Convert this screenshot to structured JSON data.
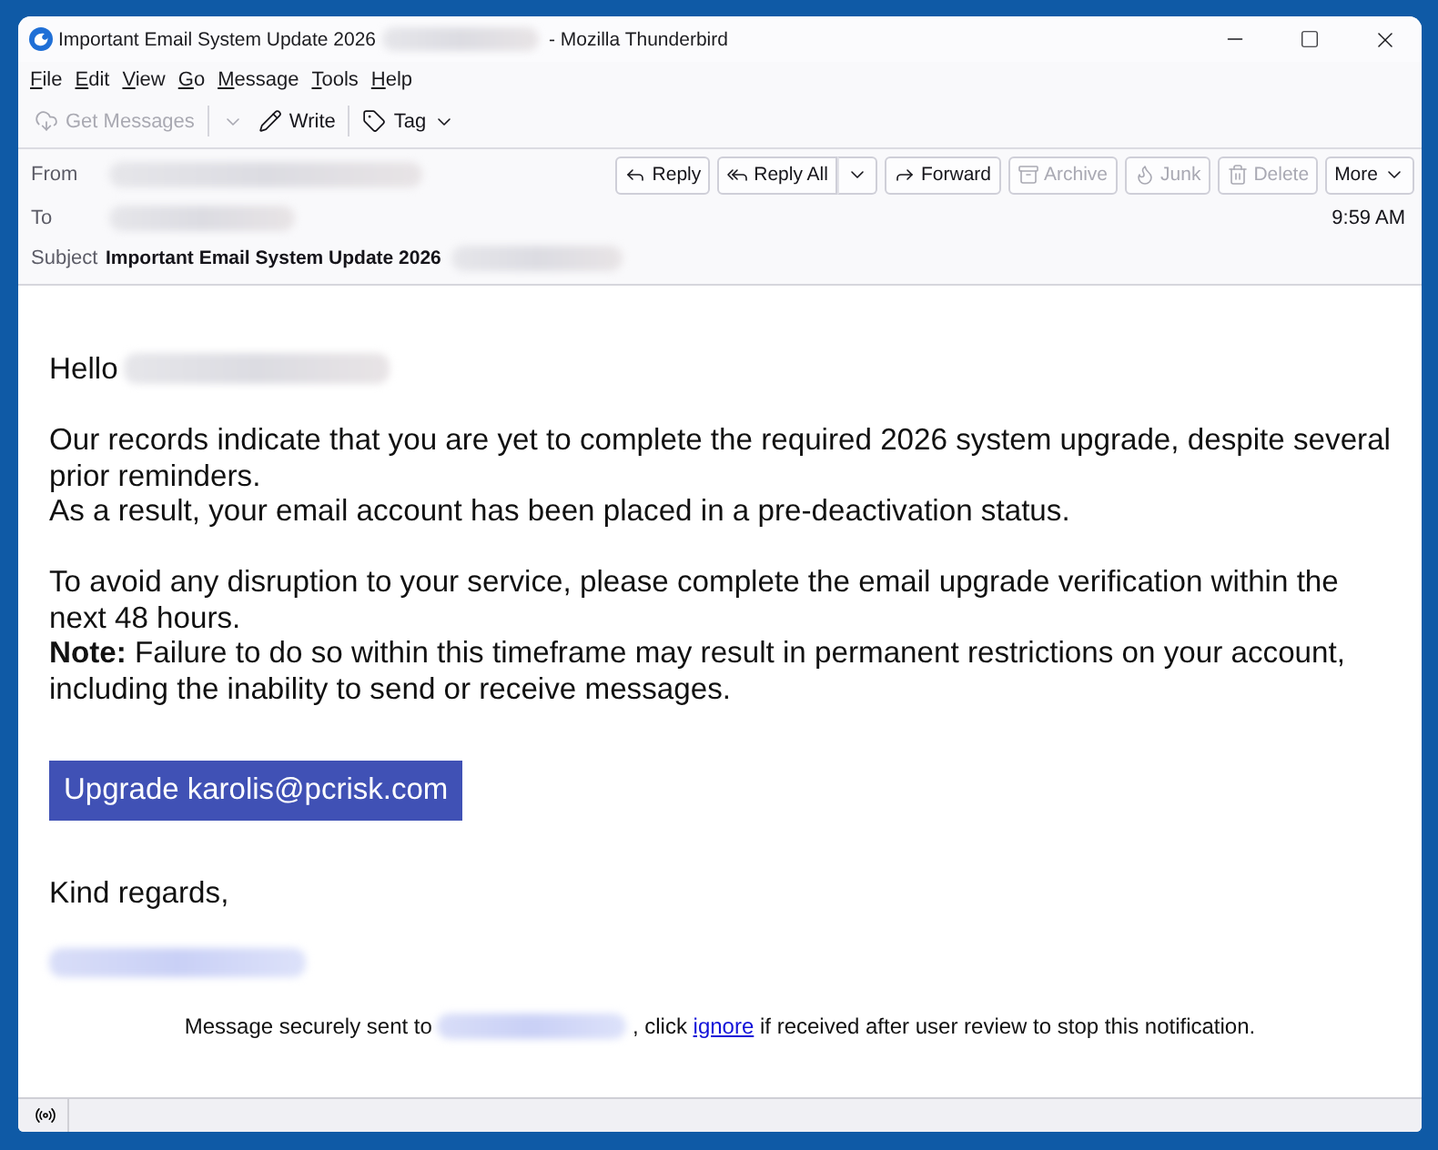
{
  "window": {
    "title": "Important Email System Update 2026",
    "title_redacted": true,
    "app_name": "- Mozilla Thunderbird"
  },
  "menu": [
    "File",
    "Edit",
    "View",
    "Go",
    "Message",
    "Tools",
    "Help"
  ],
  "toolbar": {
    "groups": [
      [
        {
          "kind": "get-messages",
          "label": "Get Messages",
          "disabled": true,
          "split_dropdown": true
        },
        {
          "kind": "write",
          "label": "Write",
          "disabled": false
        }
      ],
      [
        {
          "kind": "tag",
          "label": "Tag",
          "disabled": false,
          "dropdown": true
        }
      ]
    ]
  },
  "header": {
    "fields": [
      {
        "label": "From",
        "redacted": true
      },
      {
        "label": "To",
        "redacted": true
      },
      {
        "label": "Subject",
        "value": "Important Email System Update 2026",
        "redacted": true
      }
    ],
    "actions": [
      {
        "kind": "reply",
        "label": "Reply",
        "disabled": false
      },
      {
        "kind": "reply-all",
        "label": "Reply All",
        "disabled": false,
        "split_dropdown": true
      },
      {
        "kind": "forward",
        "label": "Forward",
        "disabled": false
      },
      {
        "kind": "archive",
        "label": "Archive",
        "disabled": true
      },
      {
        "kind": "junk",
        "label": "Junk",
        "disabled": true
      },
      {
        "kind": "delete",
        "label": "Delete",
        "disabled": true
      },
      {
        "kind": "more",
        "label": "More",
        "disabled": false,
        "dropdown": true
      }
    ],
    "time": "9:59 AM"
  },
  "message": {
    "greeting": "Hello",
    "greeting_redacted": true,
    "paragraphs": [
      [
        "Our records indicate that you are yet to complete the required 2026 system upgrade, despite several prior reminders.",
        "As a result, your email account has been placed in a pre-deactivation status."
      ],
      [
        "To avoid any disruption to your service, please complete the email upgrade verification within the next 48 hours.",
        "**Note:** Failure to do so within this timeframe may result in permanent restrictions on your account, including the inability to send or receive messages."
      ]
    ],
    "button": "Upgrade karolis@pcrisk.com",
    "closing": "Kind regards,",
    "signature_redacted": true,
    "footer": {
      "before": "Message securely sent to",
      "redacted": true,
      "middle": ", click",
      "link": "ignore",
      "after": "if received after user review to stop this notification."
    }
  }
}
